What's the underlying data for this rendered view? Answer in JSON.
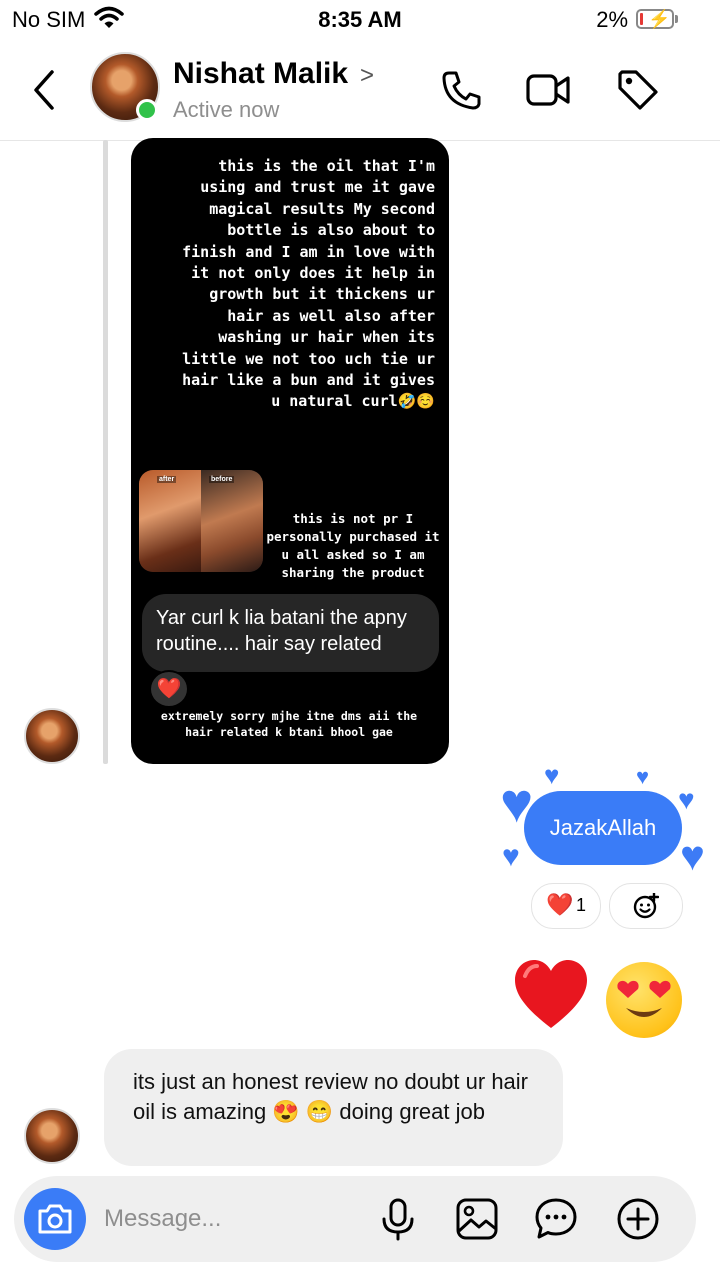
{
  "status_bar": {
    "carrier": "No SIM",
    "time": "8:35 AM",
    "battery_percent": "2%"
  },
  "header": {
    "contact_name": "Nishat Malik",
    "active_status": "Active now",
    "icons": [
      "back-icon",
      "phone-icon",
      "video-call-icon",
      "tag-icon"
    ]
  },
  "story_reply": {
    "story_text": "this is the oil that I'm using and trust me it gave magical results My second bottle is also about to finish and I am in love with it not only does it help in growth but it thickens ur hair as well also after washing ur hair when its little we not too uch tie ur hair like a bun and it gives u natural curl🤣☺️",
    "photo_labels": [
      "after",
      "before"
    ],
    "story_note": "this is not pr I personally purchased it u all asked so I am sharing the product",
    "reply_text": "Yar curl k lia batani the apny routine.... hair say related",
    "reaction": "❤️",
    "caption": "extremely sorry mjhe itne dms aii the hair related k btani bhool gae"
  },
  "messages": {
    "sent_text": "JazakAllah",
    "reaction_emoji": "❤️",
    "reaction_count": "1",
    "emoji_heart": "❤️",
    "emoji_face": "😍",
    "received_text": "its just an honest review no doubt ur hair oil is amazing 😍 😁  doing great job"
  },
  "composer": {
    "placeholder": "Message...",
    "icons": [
      "camera-icon",
      "microphone-icon",
      "gallery-icon",
      "sticker-icon",
      "plus-icon"
    ]
  },
  "colors": {
    "accent": "#3a7cf7",
    "online": "#31c24a",
    "reaction_heart": "#e31b3b"
  }
}
